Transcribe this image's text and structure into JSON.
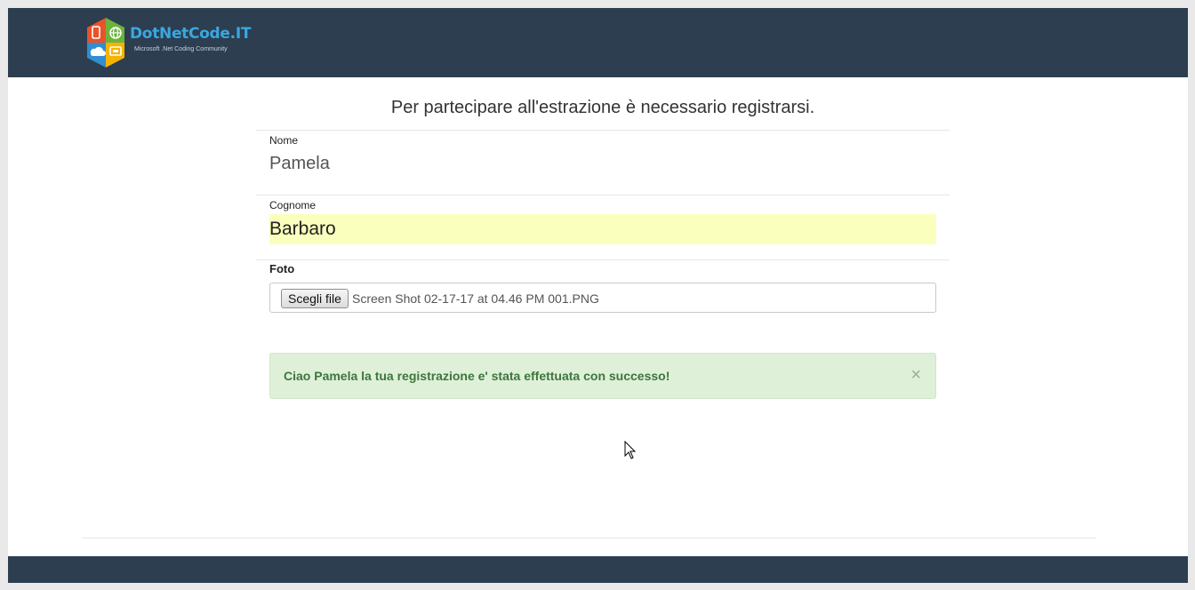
{
  "brand": {
    "name": "DotNetCode.IT",
    "tagline": "Microsoft .Net Coding Community",
    "colors": {
      "navbar": "#2c3e50",
      "brand_text": "#3aa7e0"
    }
  },
  "form": {
    "heading": "Per partecipare all'estrazione è necessario registrarsi.",
    "nome": {
      "label": "Nome",
      "value": "Pamela"
    },
    "cognome": {
      "label": "Cognome",
      "value": "Barbaro"
    },
    "foto": {
      "label": "Foto",
      "button_label": "Scegli file",
      "file_name": "Screen Shot 02-17-17 at 04.46 PM 001.PNG"
    }
  },
  "alert": {
    "message": "Ciao Pamela la tua registrazione e' stata effettuata con successo!",
    "close_symbol": "×",
    "color": "#3c763d"
  }
}
